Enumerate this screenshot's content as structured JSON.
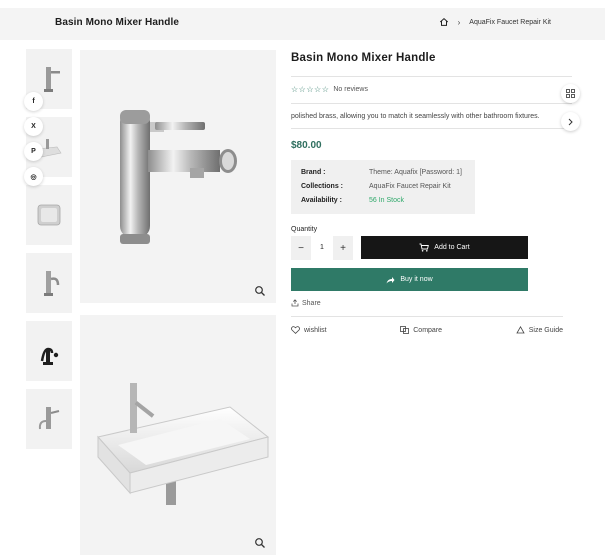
{
  "header": {
    "title": "Basin Mono Mixer Handle",
    "breadcrumb_current": "AquaFix Faucet Repair Kit",
    "breadcrumb_sep": "›"
  },
  "social": [
    "f",
    "X",
    "P",
    "◎"
  ],
  "product": {
    "title": "Basin Mono Mixer Handle",
    "stars": "☆☆☆☆☆",
    "reviews": "No reviews",
    "description": "polished brass, allowing you to match it seamlessly with other bathroom fixtures.",
    "price": "$80.00",
    "meta": [
      {
        "k": "Brand :",
        "v": "Theme: Aquafix [Password: 1]"
      },
      {
        "k": "Collections :",
        "v": "AquaFix Faucet Repair Kit"
      },
      {
        "k": "Availability :",
        "v": "56 In Stock"
      }
    ],
    "quantity_label": "Quantity",
    "quantity": "1",
    "minus": "−",
    "plus": "+",
    "add_to_cart": "Add to Cart",
    "buy_now": "Buy it now",
    "share": "Share",
    "wishlist": "wishlist",
    "compare": "Compare",
    "size_guide": "Size Guide"
  },
  "colors": {
    "accent": "#2f7a67",
    "price": "#2f6f5f",
    "stock": "#2fa86a",
    "dark_button": "#161616"
  }
}
